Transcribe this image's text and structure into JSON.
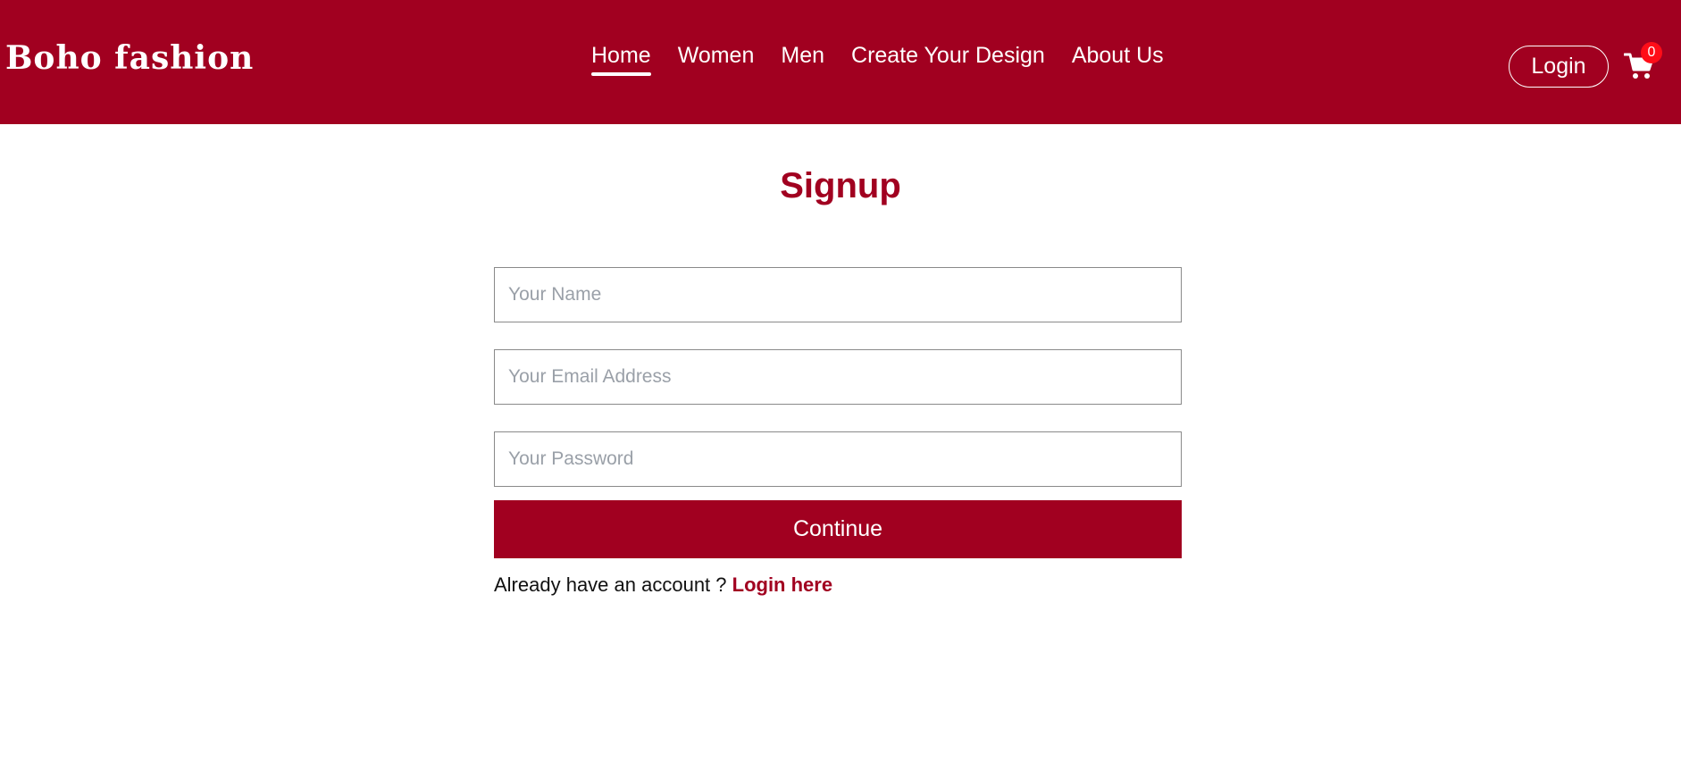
{
  "header": {
    "brand": "Boho fashion",
    "nav": [
      {
        "label": "Home",
        "active": true
      },
      {
        "label": "Women",
        "active": false
      },
      {
        "label": "Men",
        "active": false
      },
      {
        "label": "Create Your Design",
        "active": false
      },
      {
        "label": "About Us",
        "active": false
      }
    ],
    "login_label": "Login",
    "cart": {
      "icon": "cart-icon",
      "count": "0"
    }
  },
  "form": {
    "title": "Signup",
    "name_placeholder": "Your Name",
    "email_placeholder": "Your Email Address",
    "password_placeholder": "Your Password",
    "continue_label": "Continue",
    "account_prompt": "Already have an account ? ",
    "login_link": "Login here"
  },
  "colors": {
    "brand": "#a10020",
    "badge": "#ff0d18"
  }
}
